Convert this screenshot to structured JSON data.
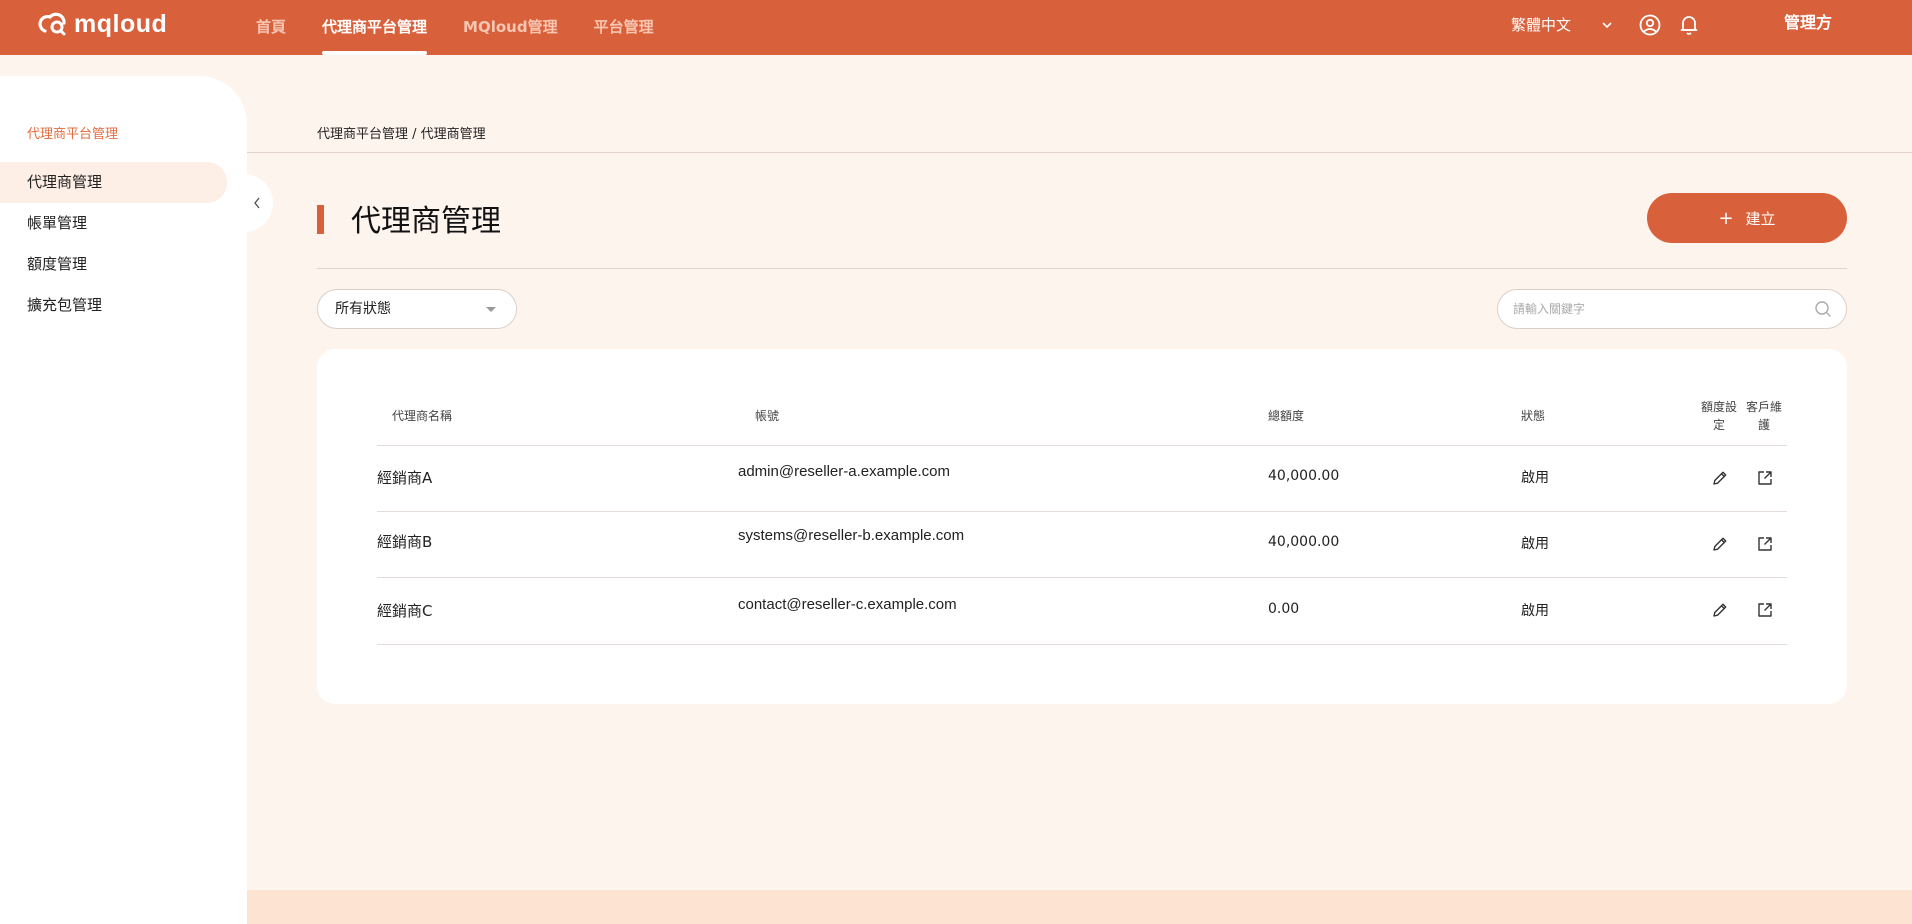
{
  "header": {
    "logo_text": "mqloud",
    "nav": [
      "首頁",
      "代理商平台管理",
      "MQloud管理",
      "平台管理"
    ],
    "active_nav": 1,
    "language": "繁體中文",
    "user_label": "管理方"
  },
  "sidebar": {
    "section_title": "代理商平台管理",
    "items": [
      {
        "label": "代理商管理",
        "active": true
      },
      {
        "label": "帳單管理",
        "active": false
      },
      {
        "label": "額度管理",
        "active": false
      },
      {
        "label": "擴充包管理",
        "active": false
      }
    ]
  },
  "main": {
    "breadcrumb": "代理商平台管理 / 代理商管理",
    "title": "代理商管理",
    "create_label": "建立",
    "status_filter": "所有狀態",
    "search_placeholder": "請輸入關鍵字"
  },
  "table": {
    "headers": {
      "name": "代理商名稱",
      "account": "帳號",
      "quota": "總額度",
      "status": "狀態",
      "quota_setting": "額度設定",
      "customer_maint": "客戶維護"
    },
    "rows": [
      {
        "name": "經銷商A",
        "account": "admin@reseller-a.example.com",
        "quota": "40,000.00",
        "status": "啟用"
      },
      {
        "name": "經銷商B",
        "account": "systems@reseller-b.example.com",
        "quota": "40,000.00",
        "status": "啟用"
      },
      {
        "name": "經銷商C",
        "account": "contact@reseller-c.example.com",
        "quota": "0.00",
        "status": "啟用"
      }
    ]
  },
  "colors": {
    "brand": "#d8603a",
    "background": "#fef4ee"
  }
}
